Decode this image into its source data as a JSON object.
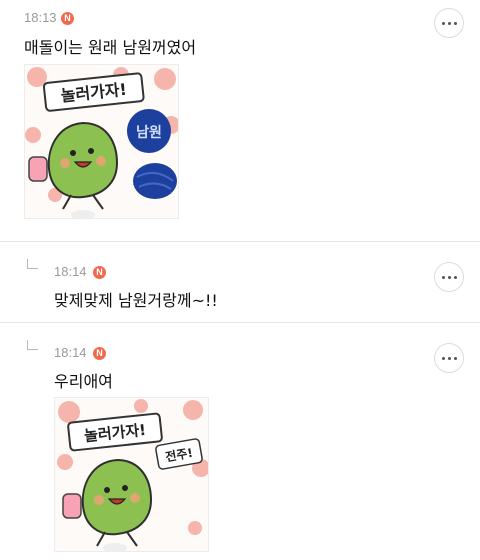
{
  "comments": [
    {
      "time": "18:13",
      "badge": "N",
      "text": "매돌이는 원래 남원꺼였어",
      "sticker": {
        "banner": "놀러가자!",
        "tag": "남원"
      }
    },
    {
      "time": "18:14",
      "badge": "N",
      "text": "맞제맞제 남원거랑께~!!"
    },
    {
      "time": "18:14",
      "badge": "N",
      "text": "우리애여",
      "sticker": {
        "banner": "놀러가자!",
        "tag": "전주!"
      }
    }
  ],
  "colors": {
    "badge": "#f06a4d",
    "blob": "#8cc152",
    "flower": "#f4a9a0",
    "ink_blue": "#1d3f9e"
  },
  "icons": {
    "more": "more-horizontal-icon",
    "reply": "reply-arrow-icon",
    "new": "new-badge-icon"
  }
}
